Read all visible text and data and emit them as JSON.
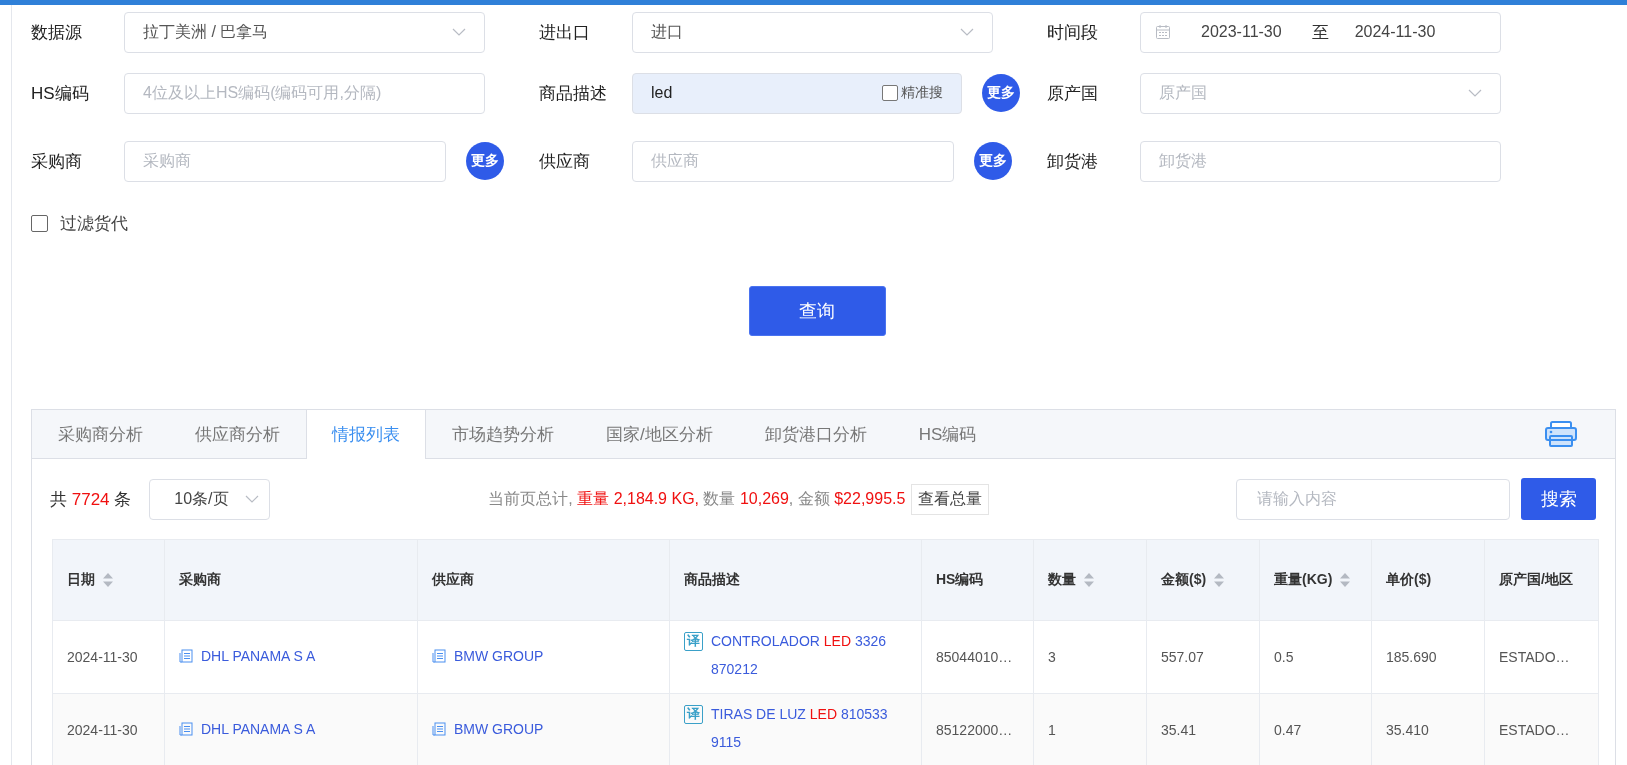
{
  "filters": {
    "data_source": {
      "label": "数据源",
      "value": "拉丁美洲 / 巴拿马"
    },
    "trade_direction": {
      "label": "进出口",
      "value": "进口"
    },
    "period": {
      "label": "时间段",
      "start": "2023-11-30",
      "separator": "至",
      "end": "2024-11-30"
    },
    "hs_code": {
      "label": "HS编码",
      "placeholder": "4位及以上HS编码(编码可用,分隔)"
    },
    "product": {
      "label": "商品描述",
      "value": "led",
      "exact_label": "精准搜",
      "exact_checked": false,
      "more": "更多"
    },
    "origin": {
      "label": "原产国",
      "placeholder": "原产国"
    },
    "buyer": {
      "label": "采购商",
      "placeholder": "采购商",
      "more": "更多"
    },
    "supplier": {
      "label": "供应商",
      "placeholder": "供应商",
      "more": "更多"
    },
    "port": {
      "label": "卸货港",
      "placeholder": "卸货港"
    },
    "forwarder": {
      "label": "过滤货代",
      "checked": false
    },
    "query_button": "查询"
  },
  "tabs": [
    {
      "label": "采购商分析",
      "selected": false
    },
    {
      "label": "供应商分析",
      "selected": false
    },
    {
      "label": "情报列表",
      "selected": true
    },
    {
      "label": "市场趋势分析",
      "selected": false
    },
    {
      "label": "国家/地区分析",
      "selected": false
    },
    {
      "label": "卸货港口分析",
      "selected": false
    },
    {
      "label": "HS编码",
      "selected": false
    }
  ],
  "toolbar": {
    "total_prefix": "共",
    "total": "7724",
    "total_suffix": "条",
    "page_size": "10条/页",
    "summary": [
      {
        "text": "当前页总计, ",
        "highlight": false
      },
      {
        "text": "重量 2,184.9 KG,",
        "highlight": true
      },
      {
        "text": " 数量 ",
        "highlight": false
      },
      {
        "text": "10,269",
        "highlight": true
      },
      {
        "text": ", 金额 ",
        "highlight": false
      },
      {
        "text": "$22,995.5",
        "highlight": true
      }
    ],
    "view_total": "查看总量",
    "search_placeholder": "请输入内容",
    "search_button": "搜索"
  },
  "table": {
    "columns": [
      {
        "label": "日期",
        "sortable": true
      },
      {
        "label": "采购商",
        "sortable": false
      },
      {
        "label": "供应商",
        "sortable": false
      },
      {
        "label": "商品描述",
        "sortable": false
      },
      {
        "label": "HS编码",
        "sortable": false
      },
      {
        "label": "数量",
        "sortable": true
      },
      {
        "label": "金额($)",
        "sortable": true
      },
      {
        "label": "重量(KG)",
        "sortable": true
      },
      {
        "label": "单价($)",
        "sortable": false
      },
      {
        "label": "原产国/地区",
        "sortable": false
      }
    ],
    "rows": [
      {
        "date": "2024-11-30",
        "buyer": "DHL PANAMA S A",
        "supplier": "BMW GROUP",
        "translate": "译",
        "description": [
          {
            "text": "CONTROLADOR ",
            "highlight": false
          },
          {
            "text": "LED",
            "highlight": true
          },
          {
            "text": " 3326 870212",
            "highlight": false
          }
        ],
        "hs_code": "85044010…",
        "quantity": "3",
        "amount": "557.07",
        "weight": "0.5",
        "unit_price": "185.690",
        "origin": "ESTADO…"
      },
      {
        "date": "2024-11-30",
        "buyer": "DHL PANAMA S A",
        "supplier": "BMW GROUP",
        "translate": "译",
        "description": [
          {
            "text": "TIRAS DE LUZ ",
            "highlight": false
          },
          {
            "text": "LED",
            "highlight": true
          },
          {
            "text": " 810533 9115",
            "highlight": false
          }
        ],
        "hs_code": "85122000…",
        "quantity": "1",
        "amount": "35.41",
        "weight": "0.47",
        "unit_price": "35.410",
        "origin": "ESTADO…"
      }
    ]
  }
}
